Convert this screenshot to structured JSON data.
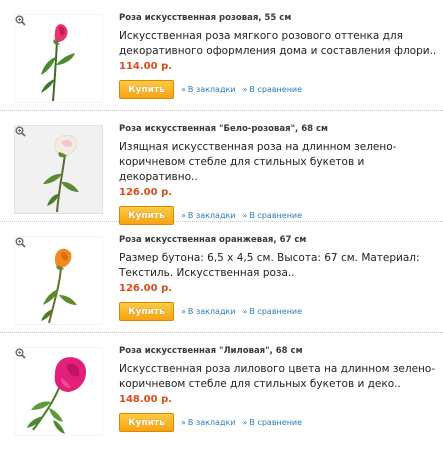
{
  "products": [
    {
      "title": "Роза искусственная розовая, 55 см",
      "description": "Искусственная роза мягкого розового оттенка для декоративного оформления дома и составления флори..",
      "price": "114.00 р.",
      "buy_label": "Купить",
      "bookmark_label": "В закладки",
      "compare_label": "В сравнение",
      "image_icon": "pink-rose-image",
      "flower_color": "#e8356b"
    },
    {
      "title": "Роза искусственная \"Бело-розовая\", 68 см",
      "description": "Изящная искусственная роза на длинном зелено-коричневом стебле для стильных букетов и декоративно..",
      "price": "126.00 р.",
      "buy_label": "Купить",
      "bookmark_label": "В закладки",
      "compare_label": "В сравнение",
      "image_icon": "white-pink-rose-image",
      "flower_color": "#f2ede0"
    },
    {
      "title": "Роза искусственная оранжевая, 67 см",
      "description": "Размер бутона: 6,5 х 4,5 см. Высота: 67 см. Материал: Текстиль. Искусственная роза..",
      "price": "126.00 р.",
      "buy_label": "Купить",
      "bookmark_label": "В закладки",
      "compare_label": "В сравнение",
      "image_icon": "orange-rose-image",
      "flower_color": "#f08a1c"
    },
    {
      "title": "Роза искусственная \"Лиловая\", 68 см",
      "description": "Искусственная роза лилового цвета на длинном зелено-коричневом стебле для стильных букетов и деко..",
      "price": "148.00 р.",
      "buy_label": "Купить",
      "bookmark_label": "В закладки",
      "compare_label": "В сравнение",
      "image_icon": "lilac-rose-image",
      "flower_color": "#e0207a"
    }
  ],
  "colors": {
    "price": "#e04b1b",
    "link": "#2a7bbf",
    "buy_button": "#f7a313"
  },
  "icons": {
    "zoom": "magnifier-icon",
    "link_arrow": "double-arrow-icon"
  }
}
